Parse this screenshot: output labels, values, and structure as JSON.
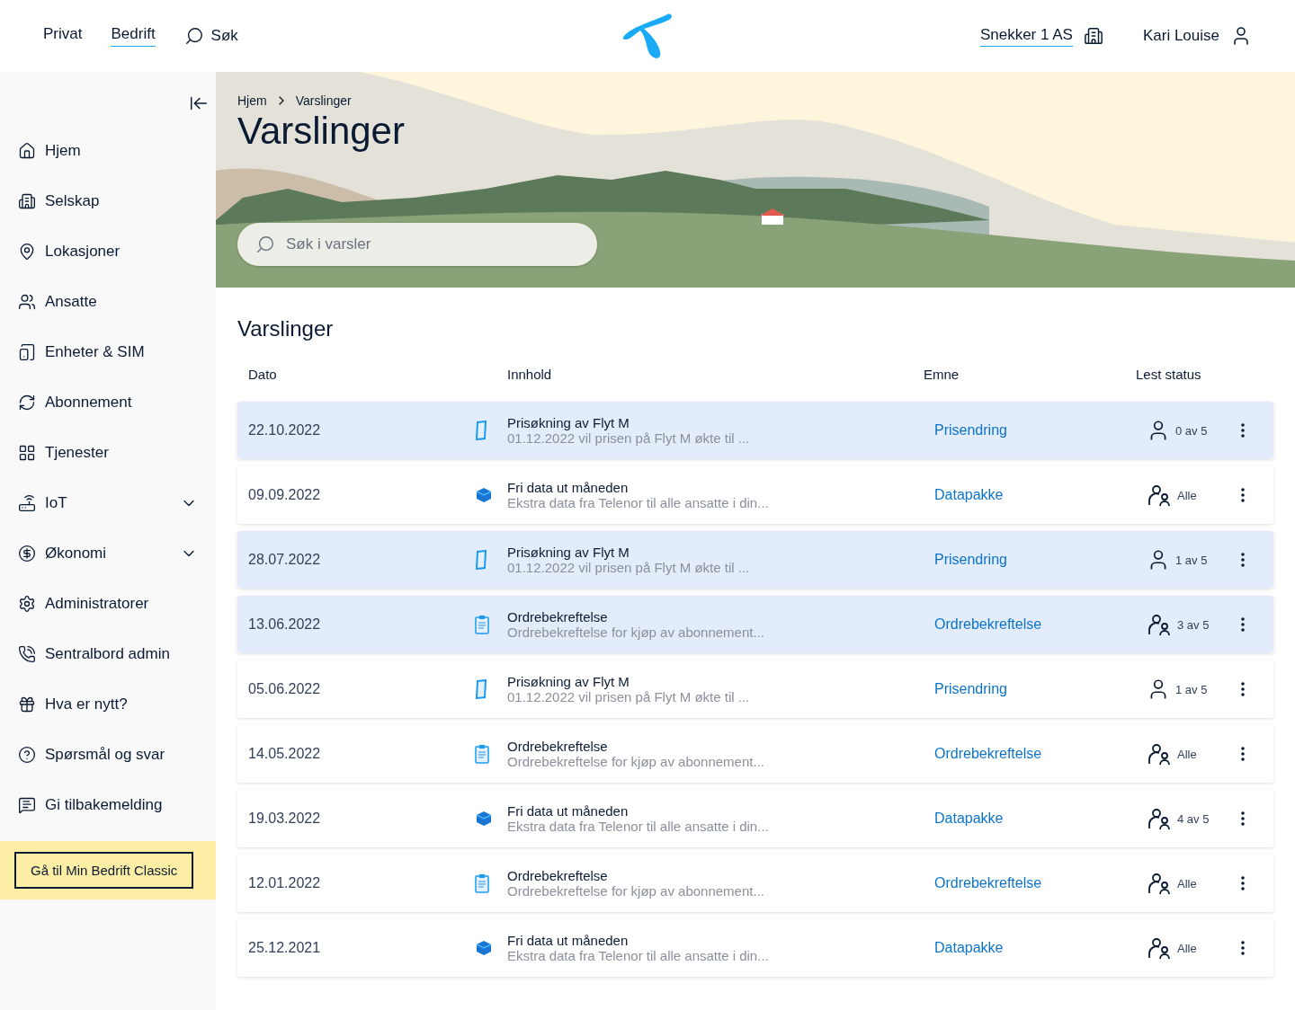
{
  "topnav": {
    "links": [
      {
        "label": "Privat",
        "selected": false
      },
      {
        "label": "Bedrift",
        "selected": true
      }
    ],
    "search": "Søk",
    "company": "Snekker 1 AS",
    "user": "Kari Louise"
  },
  "sidebar": {
    "items": [
      {
        "label": "Hjem",
        "expandable": false
      },
      {
        "label": "Selskap",
        "expandable": false
      },
      {
        "label": "Lokasjoner",
        "expandable": false
      },
      {
        "label": "Ansatte",
        "expandable": false
      },
      {
        "label": "Enheter & SIM",
        "expandable": false
      },
      {
        "label": "Abonnement",
        "expandable": false
      },
      {
        "label": "Tjenester",
        "expandable": false
      },
      {
        "label": "IoT",
        "expandable": true
      },
      {
        "label": "Økonomi",
        "expandable": true
      },
      {
        "label": "Administratorer",
        "expandable": false
      },
      {
        "label": "Sentralbord admin",
        "expandable": false
      },
      {
        "label": "Hva er nytt?",
        "expandable": false
      },
      {
        "label": "Spørsmål og svar",
        "expandable": false
      },
      {
        "label": "Gi tilbakemelding",
        "expandable": false
      }
    ],
    "classic_button": "Gå til Min Bedrift Classic"
  },
  "hero": {
    "breadcrumb": [
      "Hjem",
      "Varslinger"
    ],
    "title": "Varslinger",
    "search_placeholder": "Søk i varsler"
  },
  "table": {
    "title": "Varslinger",
    "columns": [
      "Dato",
      "Innhold",
      "Emne",
      "Lest status"
    ],
    "rows": [
      {
        "date": "22.10.2022",
        "kind": "phone",
        "title": "Prisøkning av Flyt M",
        "preview": "01.12.2022 vil prisen på Flyt M økte til ...",
        "topic": "Prisendring",
        "status": {
          "kind": "single",
          "text": "0 av 5"
        },
        "unread": true
      },
      {
        "date": "09.09.2022",
        "kind": "data",
        "title": "Fri data ut måneden",
        "preview": "Ekstra data fra Telenor til alle ansatte i din...",
        "topic": "Datapakke",
        "status": {
          "kind": "group",
          "text": "Alle"
        },
        "unread": false
      },
      {
        "date": "28.07.2022",
        "kind": "phone",
        "title": "Prisøkning av Flyt M",
        "preview": "01.12.2022 vil prisen på Flyt M økte til ...",
        "topic": "Prisendring",
        "status": {
          "kind": "single",
          "text": "1 av 5"
        },
        "unread": true
      },
      {
        "date": "13.06.2022",
        "kind": "order",
        "title": "Ordrebekreftelse",
        "preview": "Ordrebekreftelse for kjøp av abonnement...",
        "topic": "Ordrebekreftelse",
        "status": {
          "kind": "group",
          "text": "3 av 5"
        },
        "unread": true
      },
      {
        "date": "05.06.2022",
        "kind": "phone",
        "title": "Prisøkning av Flyt M",
        "preview": "01.12.2022 vil prisen på Flyt M økte til ...",
        "topic": "Prisendring",
        "status": {
          "kind": "single",
          "text": "1 av 5"
        },
        "unread": false
      },
      {
        "date": "14.05.2022",
        "kind": "order",
        "title": "Ordrebekreftelse",
        "preview": "Ordrebekreftelse for kjøp av abonnement...",
        "topic": "Ordrebekreftelse",
        "status": {
          "kind": "group",
          "text": "Alle"
        },
        "unread": false
      },
      {
        "date": "19.03.2022",
        "kind": "data",
        "title": "Fri data ut måneden",
        "preview": "Ekstra data fra Telenor til alle ansatte i din...",
        "topic": "Datapakke",
        "status": {
          "kind": "group",
          "text": "4 av 5"
        },
        "unread": false
      },
      {
        "date": "12.01.2022",
        "kind": "order",
        "title": "Ordrebekreftelse",
        "preview": "Ordrebekreftelse for kjøp av abonnement...",
        "topic": "Ordrebekreftelse",
        "status": {
          "kind": "group",
          "text": "Alle"
        },
        "unread": false
      },
      {
        "date": "25.12.2021",
        "kind": "data",
        "title": "Fri data ut måneden",
        "preview": "Ekstra data fra Telenor til alle ansatte i din...",
        "topic": "Datapakke",
        "status": {
          "kind": "group",
          "text": "Alle"
        },
        "unread": false
      }
    ]
  }
}
